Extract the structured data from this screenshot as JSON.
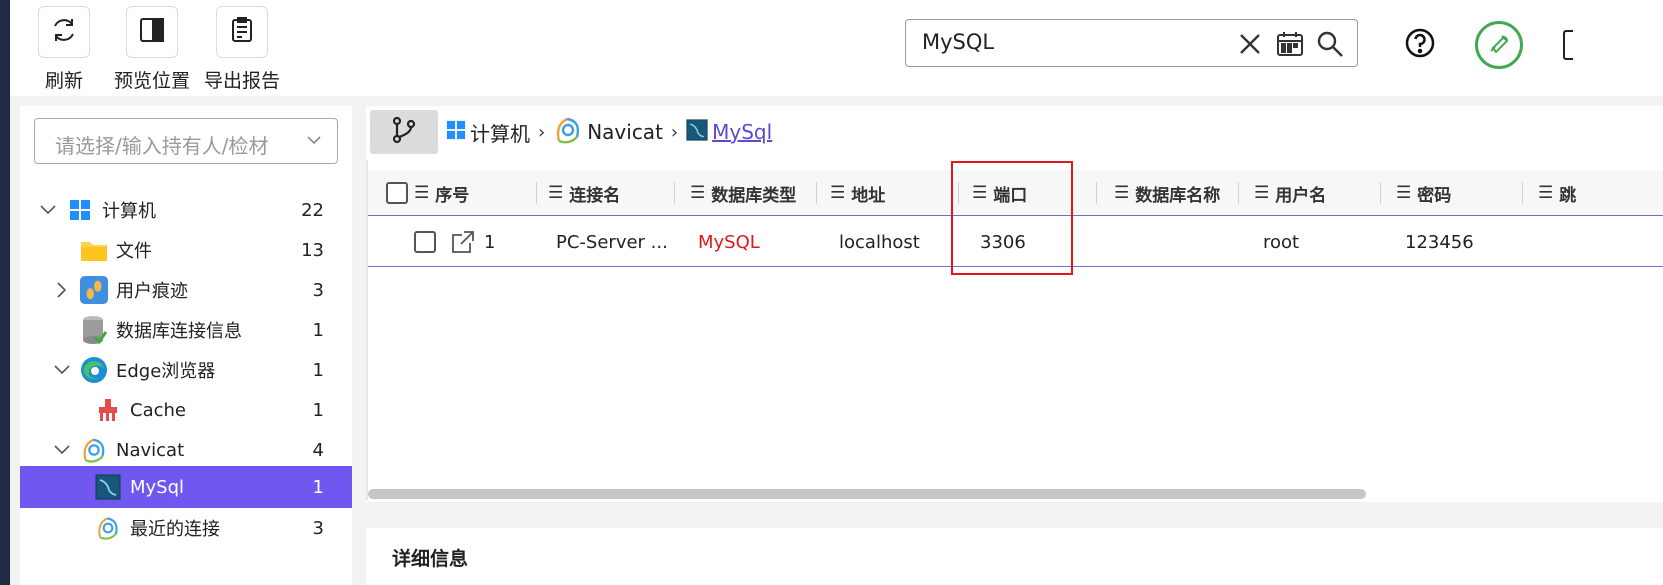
{
  "toolbar": {
    "refresh_label": "刷新",
    "preview_label": "预览位置",
    "export_label": "导出报告"
  },
  "search": {
    "value": "MySQL"
  },
  "sidebar": {
    "owner_placeholder": "请选择/输入持有人/检材",
    "tree": [
      {
        "label": "计算机",
        "count": "22",
        "icon": "windows-icon",
        "expanded": true
      },
      {
        "label": "文件",
        "count": "13",
        "icon": "folder-icon"
      },
      {
        "label": "用户痕迹",
        "count": "3",
        "icon": "user-traces-icon",
        "expanded": false
      },
      {
        "label": "数据库连接信息",
        "count": "1",
        "icon": "database-icon"
      },
      {
        "label": "Edge浏览器",
        "count": "1",
        "icon": "edge-icon",
        "expanded": true
      },
      {
        "label": "Cache",
        "count": "1",
        "icon": "cache-icon"
      },
      {
        "label": "Navicat",
        "count": "4",
        "icon": "navicat-icon",
        "expanded": true
      },
      {
        "label": "MySql",
        "count": "1",
        "icon": "mysql-icon",
        "selected": true
      },
      {
        "label": "最近的连接",
        "count": "3",
        "icon": "navicat-recent-icon"
      }
    ]
  },
  "breadcrumb": {
    "items": [
      "计算机",
      "Navicat",
      "MySql"
    ]
  },
  "table": {
    "columns": [
      "序号",
      "连接名",
      "数据库类型",
      "地址",
      "端口",
      "数据库名称",
      "用户名",
      "密码",
      "跳"
    ],
    "rows": [
      {
        "index": "1",
        "conn_name": "PC-Server ...",
        "db_type": "MySQL",
        "address": "localhost",
        "port": "3306",
        "db_name": "",
        "user": "root",
        "password": "123456"
      }
    ]
  },
  "detail": {
    "title": "详细信息"
  },
  "colors": {
    "accent": "#7057ef",
    "highlight": "#e01818",
    "db_type_text": "#e01818",
    "bell_ring": "#3faa50"
  }
}
